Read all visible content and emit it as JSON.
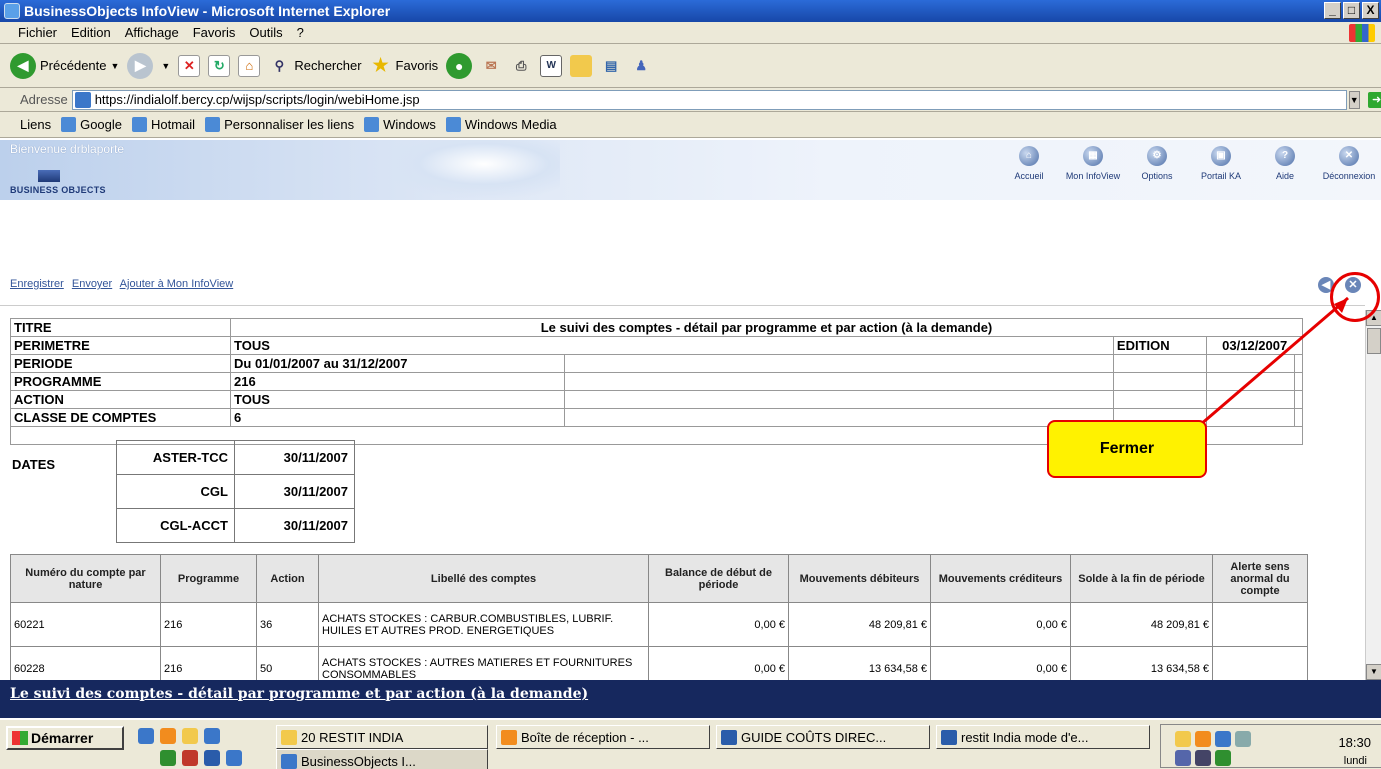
{
  "window": {
    "title": "BusinessObjects InfoView - Microsoft Internet Explorer",
    "controls": [
      "_",
      "□",
      "X"
    ]
  },
  "menu": [
    "Fichier",
    "Edition",
    "Affichage",
    "Favoris",
    "Outils",
    "?"
  ],
  "toolbar": {
    "back": "Précédente",
    "search": "Rechercher",
    "favorites": "Favoris"
  },
  "address": {
    "label": "Adresse",
    "url": "https://indialolf.bercy.cp/wijsp/scripts/login/webiHome.jsp",
    "go": "OK"
  },
  "links": {
    "label": "Liens",
    "items": [
      "Google",
      "Hotmail",
      "Personnaliser les liens",
      "Windows",
      "Windows Media"
    ]
  },
  "bo": {
    "welcome": "Bienvenue drblaporte",
    "logo": "BUSINESS OBJECTS",
    "nav": [
      "Accueil",
      "Mon InfoView",
      "Options",
      "Portail KA",
      "Aide",
      "Déconnexion"
    ]
  },
  "actions": [
    "Enregistrer",
    "Envoyer",
    "Ajouter à Mon InfoView"
  ],
  "report_header": {
    "titre_label": "TITRE",
    "titre_value": "Le suivi des comptes - détail par programme et par action (à la demande)",
    "perimetre_label": "PERIMETRE",
    "perimetre_value": "TOUS",
    "edition_label": "EDITION",
    "edition_value": "03/12/2007",
    "periode_label": "PERIODE",
    "periode_value": "Du 01/01/2007 au 31/12/2007",
    "programme_label": "PROGRAMME",
    "programme_value": "216",
    "action_label": "ACTION",
    "action_value": "TOUS",
    "classe_label": "CLASSE DE COMPTES",
    "classe_value": "6"
  },
  "dates": {
    "label": "DATES",
    "rows": [
      {
        "name": "ASTER-TCC",
        "date": "30/11/2007"
      },
      {
        "name": "CGL",
        "date": "30/11/2007"
      },
      {
        "name": "CGL-ACCT",
        "date": "30/11/2007"
      }
    ]
  },
  "table": {
    "columns": [
      "Numéro du compte par nature",
      "Programme",
      "Action",
      "Libellé des comptes",
      "Balance de début de période",
      "Mouvements débiteurs",
      "Mouvements créditeurs",
      "Solde à la fin de période",
      "Alerte sens anormal du compte"
    ],
    "rows": [
      {
        "compte": "60221",
        "programme": "216",
        "action": "36",
        "libelle": "ACHATS STOCKES : CARBUR.COMBUSTIBLES, LUBRIF.  HUILES ET AUTRES PROD.  ENERGETIQUES",
        "balance": "0,00 €",
        "debit": "48 209,81 €",
        "credit": "0,00 €",
        "solde": "48 209,81 €",
        "alerte": ""
      },
      {
        "compte": "60228",
        "programme": "216",
        "action": "50",
        "libelle": "ACHATS STOCKES : AUTRES MATIERES ET FOURNITURES CONSOMMABLES",
        "balance": "0,00 €",
        "debit": "13 634,58 €",
        "credit": "0,00 €",
        "solde": "13 634,58 €",
        "alerte": ""
      }
    ]
  },
  "footer_title": "Le suivi des comptes - détail par programme et par action (à la demande)",
  "callout": "Fermer",
  "taskbar": {
    "start": "Démarrer",
    "buttons": [
      "20 RESTIT INDIA",
      "BusinessObjects I...",
      "Boîte de réception - ...",
      "GUIDE COÛTS DIREC...",
      "restit India mode d'e..."
    ],
    "time": "18:30",
    "day": "lundi"
  },
  "colors": {
    "accent": "#16285e",
    "callout_fill": "#fff200",
    "callout_border": "#e60000"
  }
}
